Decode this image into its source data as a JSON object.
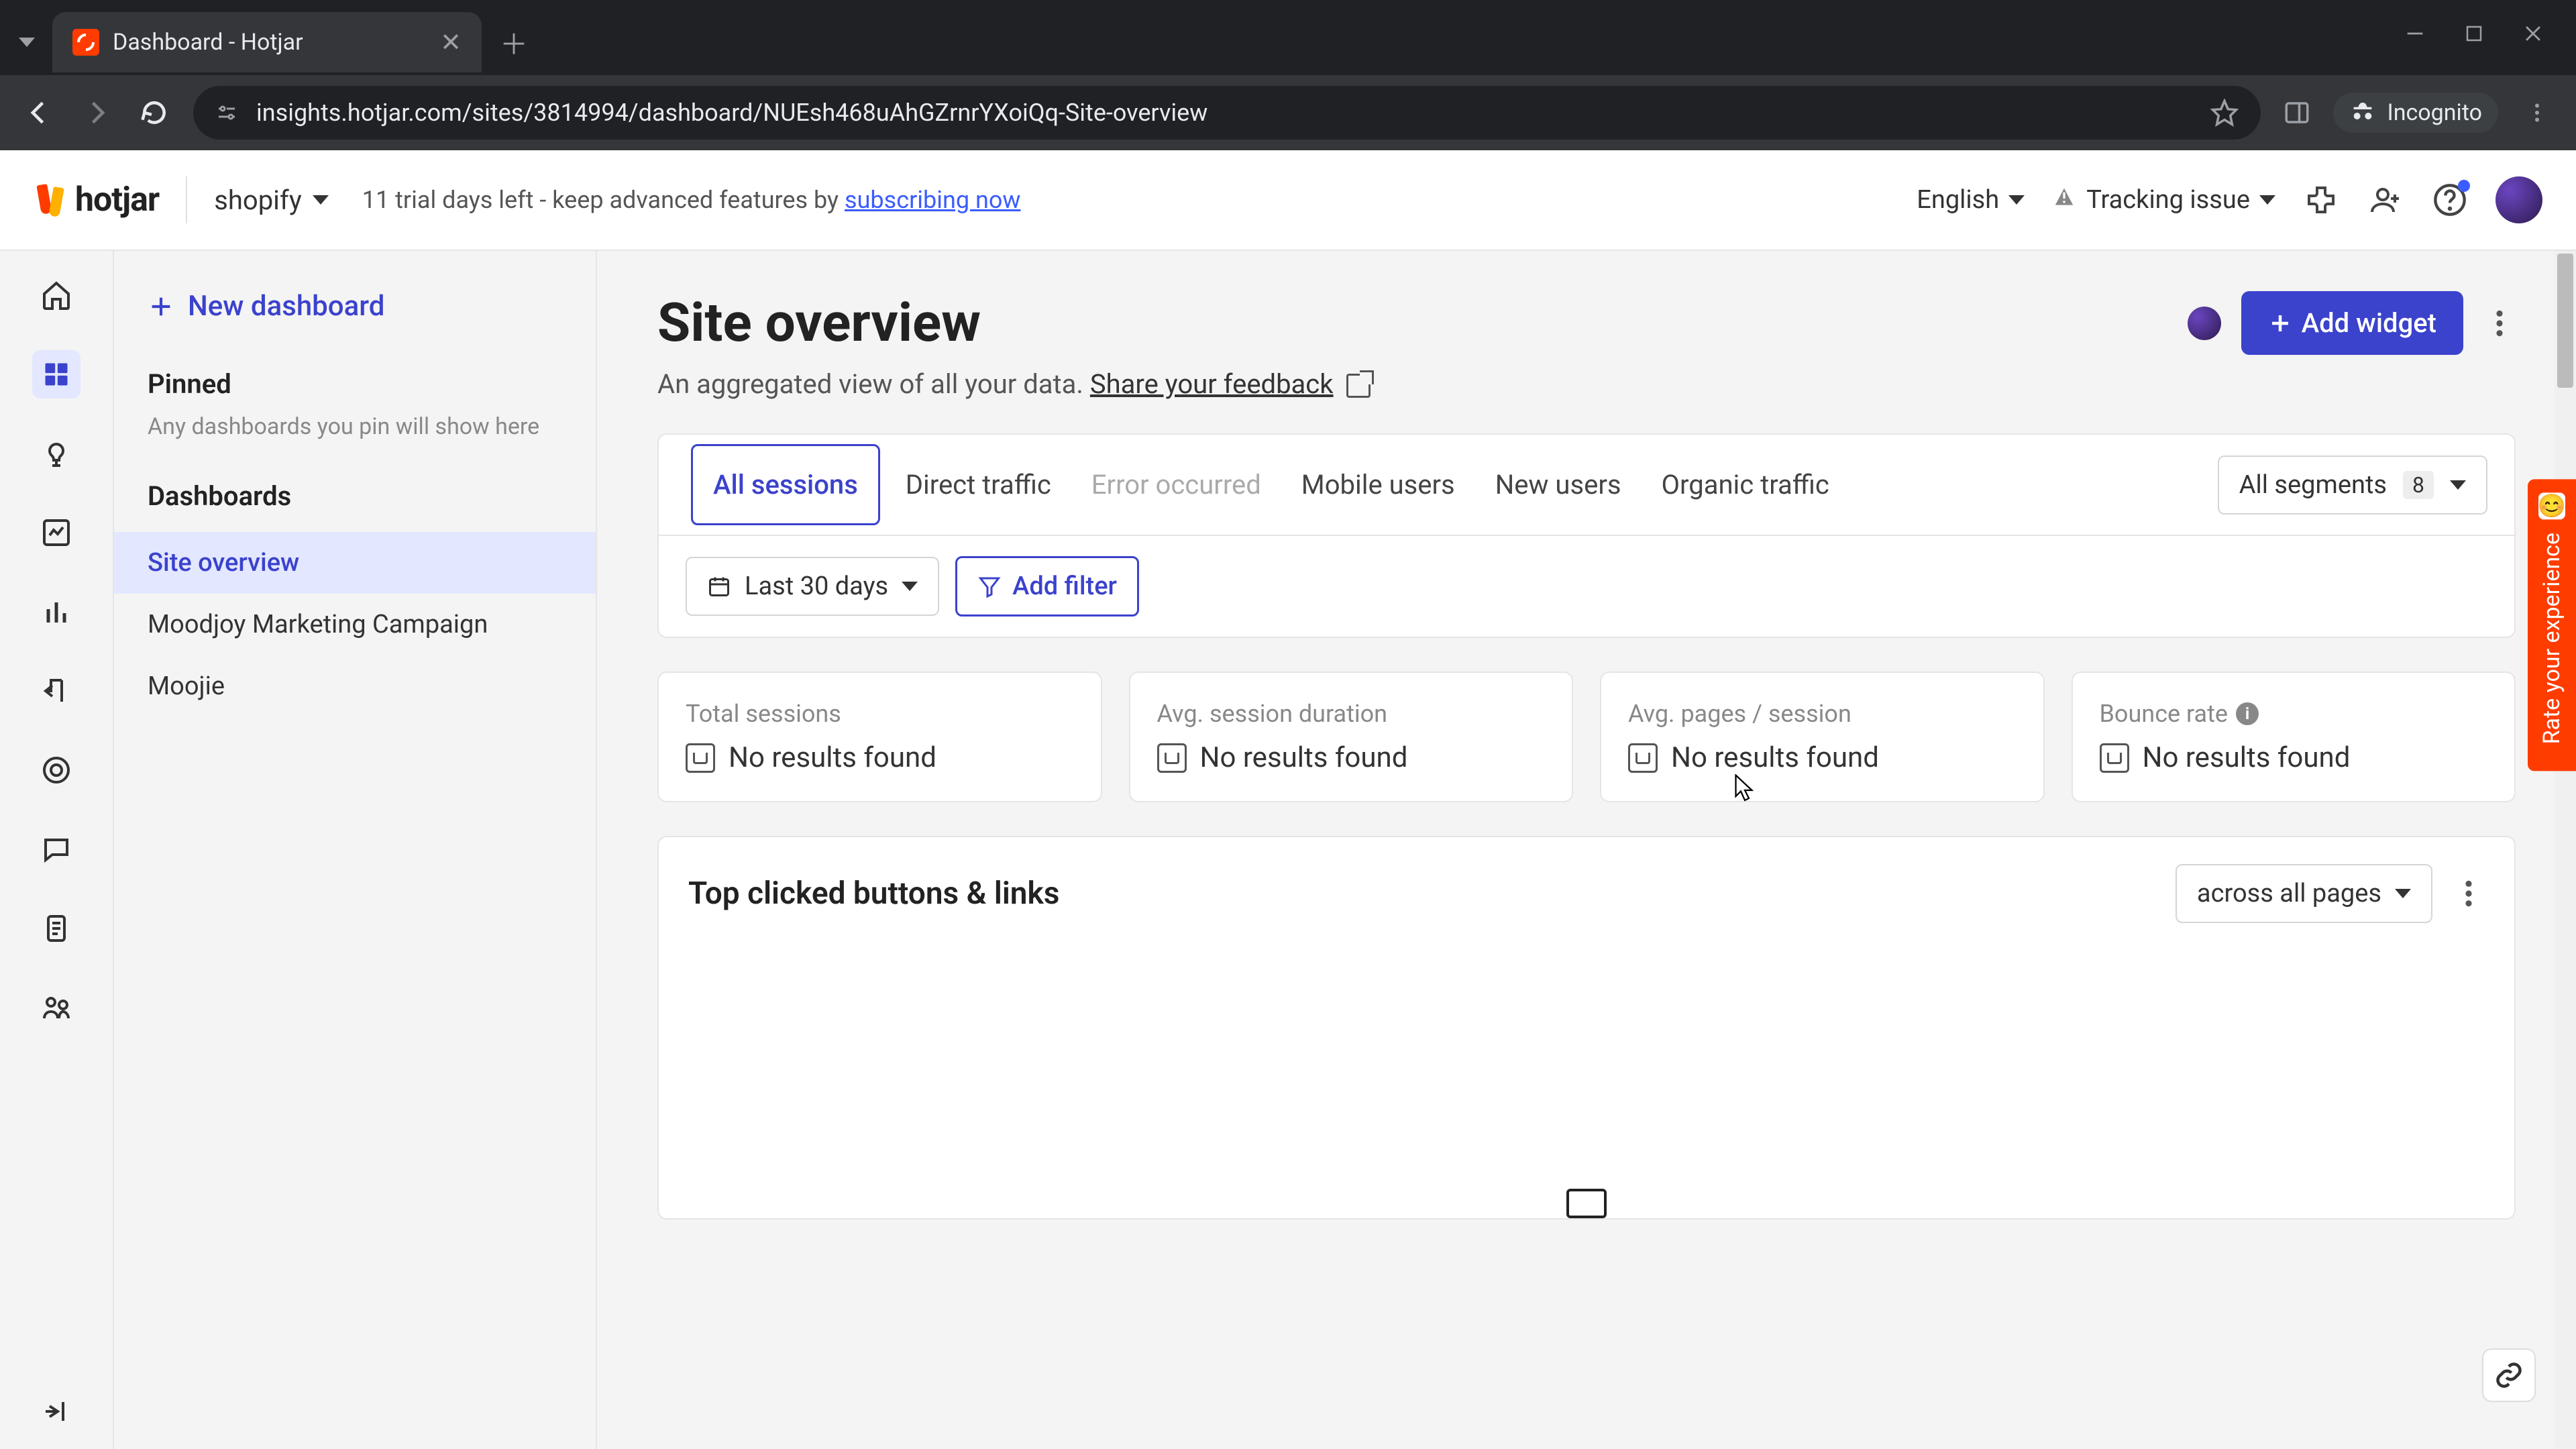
{
  "browser": {
    "tab_title": "Dashboard - Hotjar",
    "url": "insights.hotjar.com/sites/3814994/dashboard/NUEsh468uAhGZrnrYXoiQq-Site-overview",
    "incognito_label": "Incognito"
  },
  "topbar": {
    "logo_text": "hotjar",
    "site_name": "shopify",
    "trial_prefix": "11 trial days left - keep advanced features by ",
    "trial_link": "subscribing now",
    "language": "English",
    "tracking_issue": "Tracking issue"
  },
  "sidebar": {
    "new_dashboard": "New dashboard",
    "pinned_title": "Pinned",
    "pinned_hint": "Any dashboards you pin will show here",
    "dashboards_title": "Dashboards",
    "items": [
      {
        "label": "Site overview",
        "active": true
      },
      {
        "label": "Moodjoy Marketing Campaign",
        "active": false
      },
      {
        "label": "Moojie",
        "active": false
      }
    ]
  },
  "main": {
    "title": "Site overview",
    "subtitle_text": "An aggregated view of all your data. ",
    "subtitle_link": "Share your feedback",
    "add_widget": "Add widget",
    "filters": {
      "tabs": [
        {
          "label": "All sessions",
          "state": "active"
        },
        {
          "label": "Direct traffic",
          "state": "normal"
        },
        {
          "label": "Error occurred",
          "state": "disabled"
        },
        {
          "label": "Mobile users",
          "state": "normal"
        },
        {
          "label": "New users",
          "state": "normal"
        },
        {
          "label": "Organic traffic",
          "state": "normal"
        }
      ],
      "segments_label": "All segments",
      "segments_count": "8",
      "date_label": "Last 30 days",
      "add_filter": "Add filter"
    },
    "metrics": [
      {
        "label": "Total sessions",
        "value": "No results found",
        "info": false
      },
      {
        "label": "Avg. session duration",
        "value": "No results found",
        "info": false
      },
      {
        "label": "Avg. pages / session",
        "value": "No results found",
        "info": false
      },
      {
        "label": "Bounce rate",
        "value": "No results found",
        "info": true
      }
    ],
    "widget": {
      "title": "Top clicked buttons & links",
      "scope": "across all pages"
    }
  },
  "feedback_tab": "Rate your experience",
  "icons": {
    "home": "home-icon",
    "dashboard": "dashboard-icon",
    "bulb": "bulb-icon",
    "trend": "trend-icon",
    "bars": "bars-icon",
    "funnel": "funnel-icon",
    "target": "target-icon",
    "chat": "chat-icon",
    "clipboard": "clipboard-icon",
    "people": "people-icon",
    "expand": "expand-icon"
  }
}
